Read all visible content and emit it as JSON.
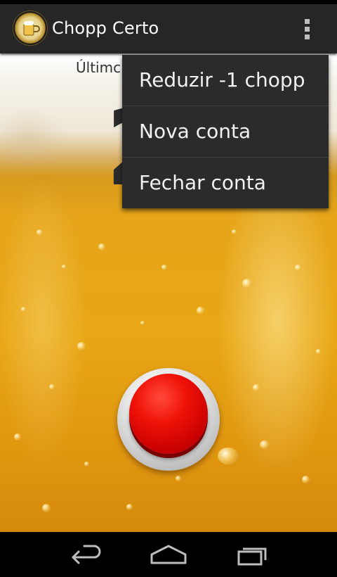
{
  "app": {
    "title": "Chopp Certo",
    "icon": "beer-mug-logo-icon"
  },
  "main": {
    "last_label": "Últimc",
    "counter": "2"
  },
  "menu": {
    "items": [
      {
        "label": "Reduzir -1 chopp"
      },
      {
        "label": "Nova conta"
      },
      {
        "label": "Fechar conta"
      }
    ]
  },
  "colors": {
    "action_bar": "#262626",
    "menu_background": "#2b2b2b",
    "button_red": "#f01208",
    "beer": "#e9a716"
  },
  "nav": {
    "icons": [
      "back-icon",
      "home-icon",
      "recent-apps-icon"
    ]
  }
}
